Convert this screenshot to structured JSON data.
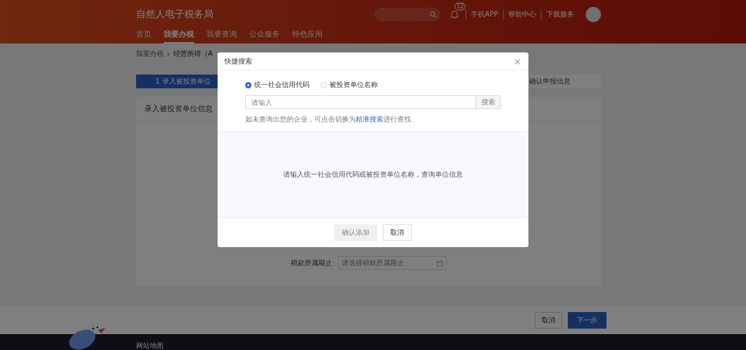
{
  "header": {
    "title": "自然人电子税务局",
    "nav": [
      {
        "label": "首页",
        "selected": false
      },
      {
        "label": "我要办税",
        "selected": true
      },
      {
        "label": "我要查询",
        "selected": false
      },
      {
        "label": "公众服务",
        "selected": false
      },
      {
        "label": "特色应用",
        "selected": false
      }
    ],
    "badge": "12",
    "links": [
      "手机APP",
      "帮助中心",
      "下载服务"
    ]
  },
  "breadcrumb": [
    "我要办税",
    "›",
    "经营所得（A"
  ],
  "steps": [
    {
      "number": "1",
      "label": "录入被投资单位",
      "selected": true
    },
    {
      "label": "确认申报信息",
      "selected": false
    }
  ],
  "card": {
    "title": "录入被投资单位信息",
    "field_label": "税款所属期止",
    "field_placeholder": "请选择税款所属期止"
  },
  "footer_buttons": [
    {
      "label": "取消",
      "kind": "secondary"
    },
    {
      "label": "下一步",
      "kind": "primary"
    }
  ],
  "site_footer": {
    "link": "网站地图"
  },
  "dialog": {
    "title": "快捷搜索",
    "close": "×",
    "radios": [
      {
        "label": "统一社会信用代码",
        "selected": true
      },
      {
        "label": "被投资单位名称",
        "selected": false
      }
    ],
    "search": {
      "placeholder": "请输入",
      "button": "搜索"
    },
    "hint": "如未查询出您的企业，可点击切换为",
    "hint_link": "精准搜索",
    "hint_end": "进行查找",
    "empty_message": "请输入统一社会信用代码或被投资单位名称，查询单位信息",
    "buttons": [
      {
        "label": "确认添加",
        "disabled": true
      },
      {
        "label": "取消",
        "disabled": false
      }
    ]
  }
}
